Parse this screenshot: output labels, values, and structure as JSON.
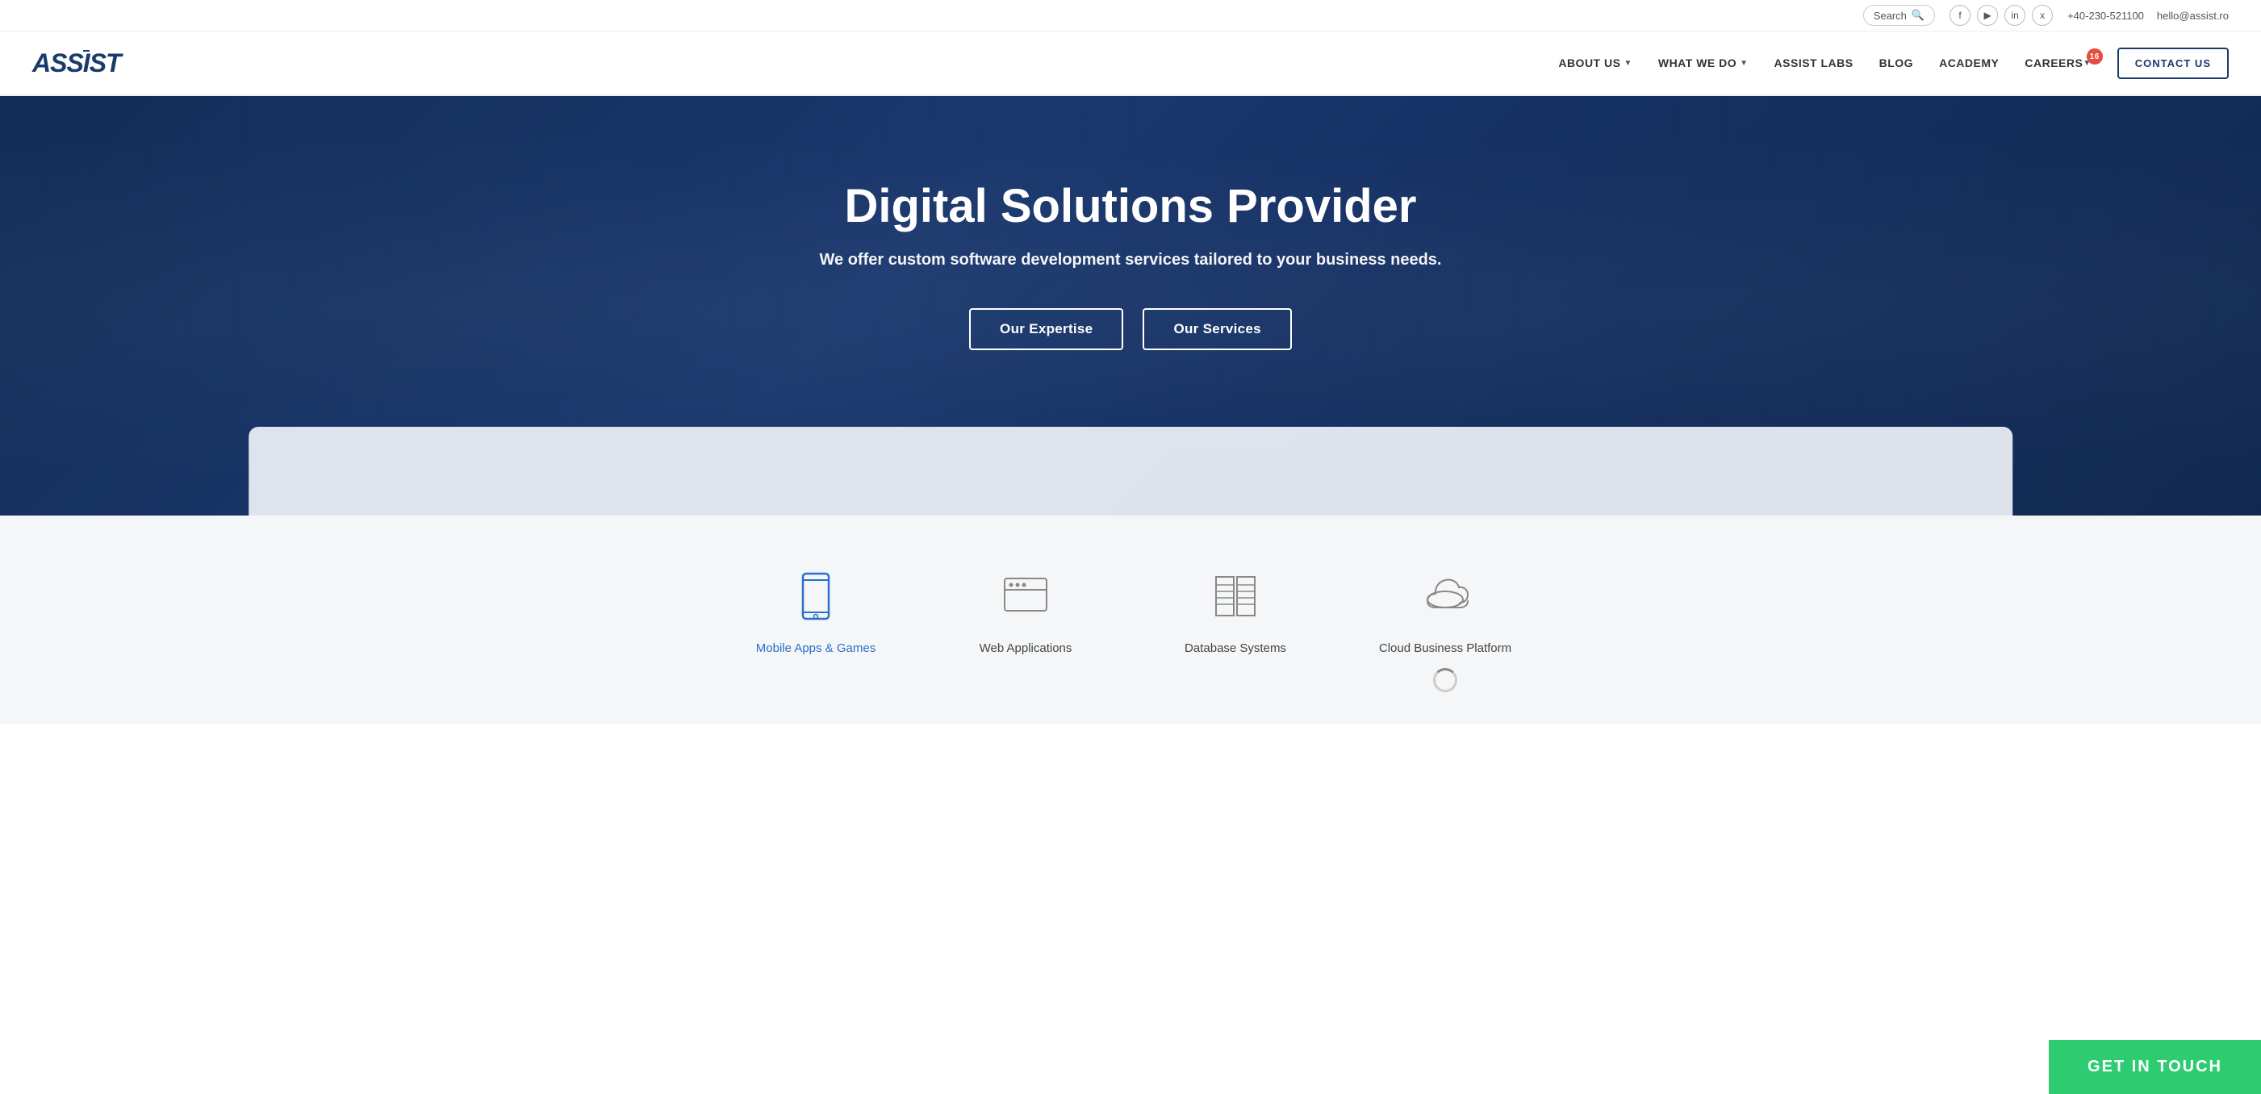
{
  "topbar": {
    "search_label": "Search",
    "phone": "+40-230-521100",
    "email": "hello@assist.ro",
    "social": [
      {
        "name": "facebook",
        "symbol": "f"
      },
      {
        "name": "youtube",
        "symbol": "▶"
      },
      {
        "name": "linkedin",
        "symbol": "in"
      },
      {
        "name": "xing",
        "symbol": "x"
      }
    ]
  },
  "nav": {
    "logo": "ASSIST",
    "items": [
      {
        "label": "ABOUT US",
        "has_dropdown": true
      },
      {
        "label": "WHAT WE DO",
        "has_dropdown": true
      },
      {
        "label": "ASSIST LABS",
        "has_dropdown": false
      },
      {
        "label": "BLOG",
        "has_dropdown": false
      },
      {
        "label": "ACADEMY",
        "has_dropdown": false
      },
      {
        "label": "CAREERS",
        "has_dropdown": true,
        "badge": "16"
      }
    ],
    "contact_label": "CONTACT US"
  },
  "hero": {
    "title": "Digital Solutions Provider",
    "subtitle": "We offer custom software development services tailored to your business needs.",
    "btn_expertise": "Our Expertise",
    "btn_services": "Our Services"
  },
  "services": {
    "items": [
      {
        "label": "Mobile Apps & Games",
        "active": true,
        "icon": "mobile"
      },
      {
        "label": "Web Applications",
        "active": false,
        "icon": "web"
      },
      {
        "label": "Database Systems",
        "active": false,
        "icon": "database"
      },
      {
        "label": "Cloud Business Platform",
        "active": false,
        "icon": "cloud"
      }
    ]
  },
  "cta": {
    "label": "GET IN TOUCH"
  }
}
